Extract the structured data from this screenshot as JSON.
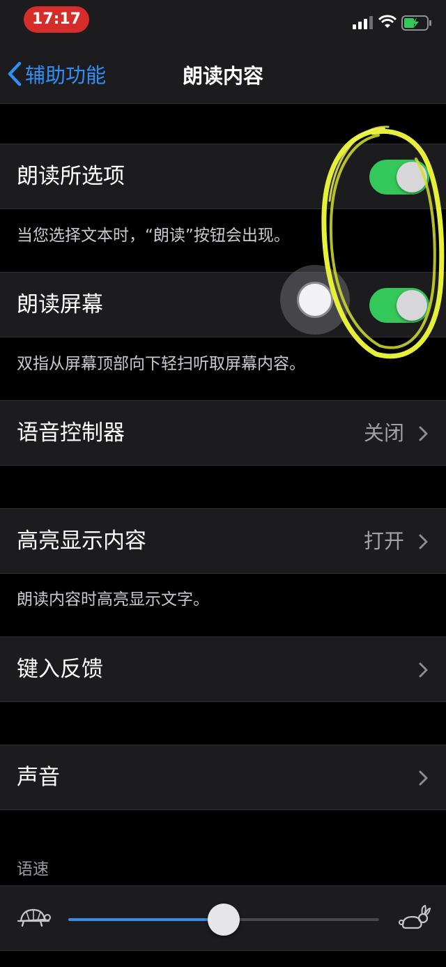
{
  "status_bar": {
    "time": "17:17",
    "icons": [
      "signal-bars-icon",
      "wifi-icon",
      "battery-charging-icon"
    ]
  },
  "nav": {
    "back_label": "辅助功能",
    "title": "朗读内容"
  },
  "speak_selection": {
    "label": "朗读所选项",
    "enabled": true,
    "footer": "当您选择文本时，“朗读”按钮会出现。"
  },
  "speak_screen": {
    "label": "朗读屏幕",
    "enabled": true,
    "footer": "双指从屏幕顶部向下轻扫听取屏幕内容。"
  },
  "speech_controller": {
    "label": "语音控制器",
    "value": "关闭"
  },
  "highlight_content": {
    "label": "高亮显示内容",
    "value": "打开",
    "footer": "朗读内容时高亮显示文字。"
  },
  "typing_feedback": {
    "label": "键入反馈"
  },
  "voices": {
    "label": "声音"
  },
  "speaking_rate": {
    "header": "语速",
    "value_fraction": 0.5,
    "min_icon": "turtle-icon",
    "max_icon": "rabbit-icon"
  },
  "colors": {
    "accent": "#2f8ff5",
    "toggle_on": "#34c759",
    "time_pill": "#d62d2a",
    "annotation": "#e6f03a"
  }
}
